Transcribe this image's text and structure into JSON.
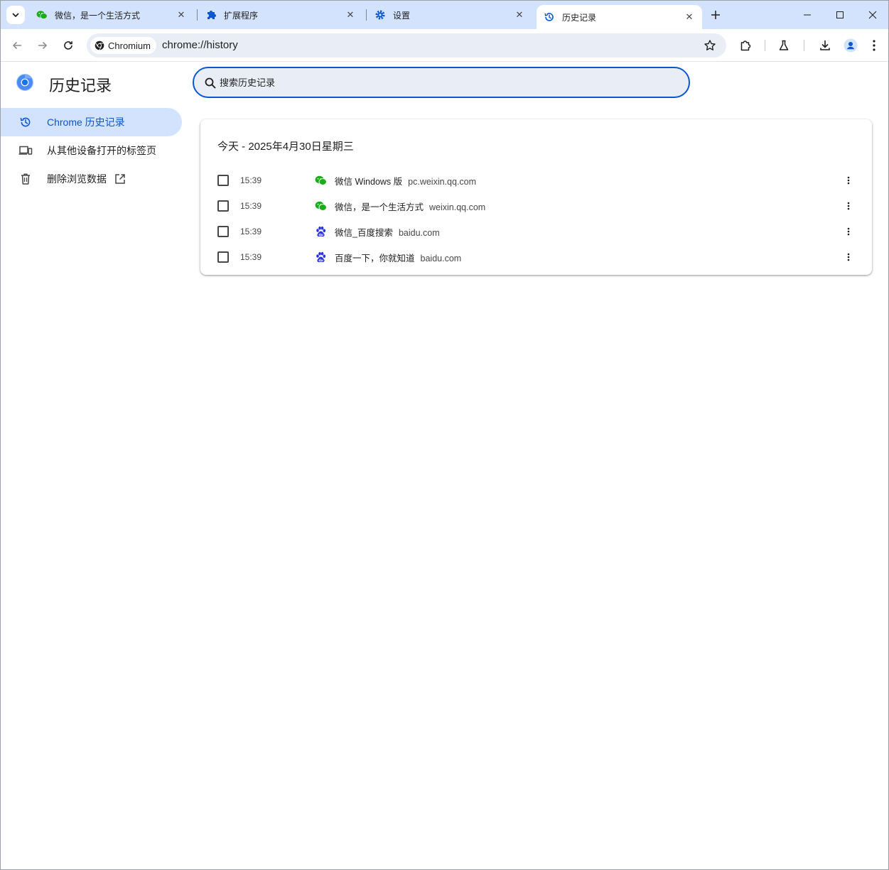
{
  "tabs": [
    {
      "title": "微信，是一个生活方式",
      "icon": "wechat-icon"
    },
    {
      "title": "扩展程序",
      "icon": "puzzle-icon"
    },
    {
      "title": "设置",
      "icon": "gear-icon"
    },
    {
      "title": "历史记录",
      "icon": "history-icon",
      "active": true
    }
  ],
  "toolbar": {
    "chip_label": "Chromium",
    "url": "chrome://history"
  },
  "page": {
    "title": "历史记录",
    "search_placeholder": "搜索历史记录"
  },
  "sidebar": {
    "items": [
      {
        "label": "Chrome 历史记录",
        "icon": "history-icon",
        "selected": true
      },
      {
        "label": "从其他设备打开的标签页",
        "icon": "devices-icon"
      },
      {
        "label": "删除浏览数据",
        "icon": "trash-icon"
      }
    ]
  },
  "history": {
    "heading": "今天 - 2025年4月30日星期三",
    "entries": [
      {
        "time": "15:39",
        "title": "微信 Windows 版",
        "domain": "pc.weixin.qq.com",
        "icon": "wechat-icon"
      },
      {
        "time": "15:39",
        "title": "微信，是一个生活方式",
        "domain": "weixin.qq.com",
        "icon": "wechat-icon"
      },
      {
        "time": "15:39",
        "title": "微信_百度搜索",
        "domain": "baidu.com",
        "icon": "baidu-icon"
      },
      {
        "time": "15:39",
        "title": "百度一下，你就知道",
        "domain": "baidu.com",
        "icon": "baidu-icon"
      }
    ]
  },
  "colors": {
    "tabstrip": "#d3e3fd",
    "accent": "#0b57d0",
    "wechat": "#1aad19",
    "baidu": "#2932e1"
  }
}
